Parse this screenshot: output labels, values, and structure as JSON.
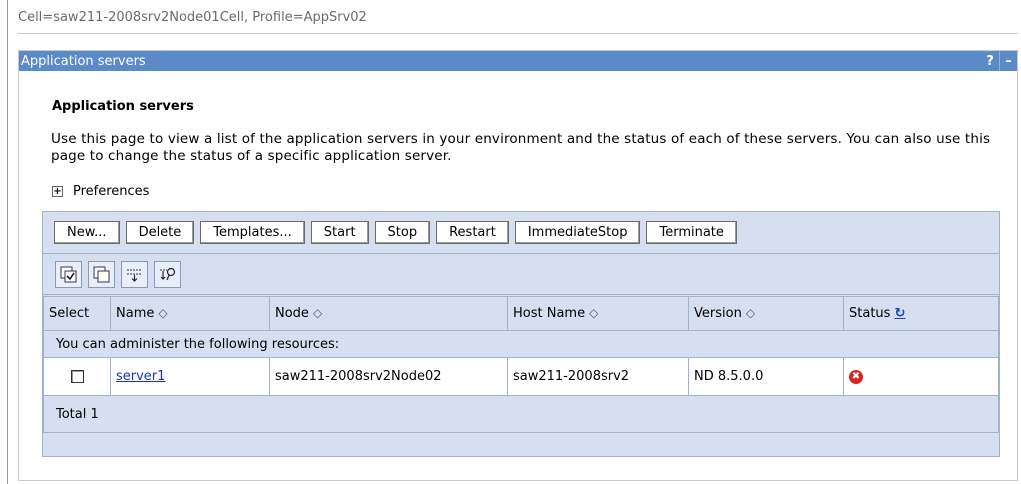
{
  "context": {
    "breadcrumb": "Cell=saw211-2008srv2Node01Cell, Profile=AppSrv02"
  },
  "portlet": {
    "title": "Application servers",
    "help_label": "?",
    "minimize_label": "–"
  },
  "main": {
    "heading": "Application servers",
    "description": "Use this page to view a list of the application servers in your environment and the status of each of these servers. You can also use this page to change the status of a specific application server.",
    "preferences_label": "Preferences",
    "preferences_toggle": "+"
  },
  "toolbar": {
    "buttons": [
      "New...",
      "Delete",
      "Templates...",
      "Start",
      "Stop",
      "Restart",
      "ImmediateStop",
      "Terminate"
    ]
  },
  "icon_toolbar": {
    "icons": [
      "select-all-icon",
      "deselect-all-icon",
      "show-filter-icon",
      "clear-filter-icon"
    ]
  },
  "table": {
    "headers": [
      "Select",
      "Name",
      "Node",
      "Host Name",
      "Version",
      "Status"
    ],
    "sort_glyph": "◇",
    "refresh_glyph": "↻",
    "message": "You can administer the following resources:",
    "rows": [
      {
        "name": "server1",
        "node": "saw211-2008srv2Node02",
        "host": "saw211-2008srv2",
        "version": "ND 8.5.0.0",
        "status": "stopped",
        "status_glyph": "✖"
      }
    ],
    "total": "Total 1"
  },
  "colors": {
    "titlebar": "#5a8ac7",
    "panel": "#d6dff0",
    "link": "#1b33b5",
    "status_stopped": "#d22222"
  }
}
